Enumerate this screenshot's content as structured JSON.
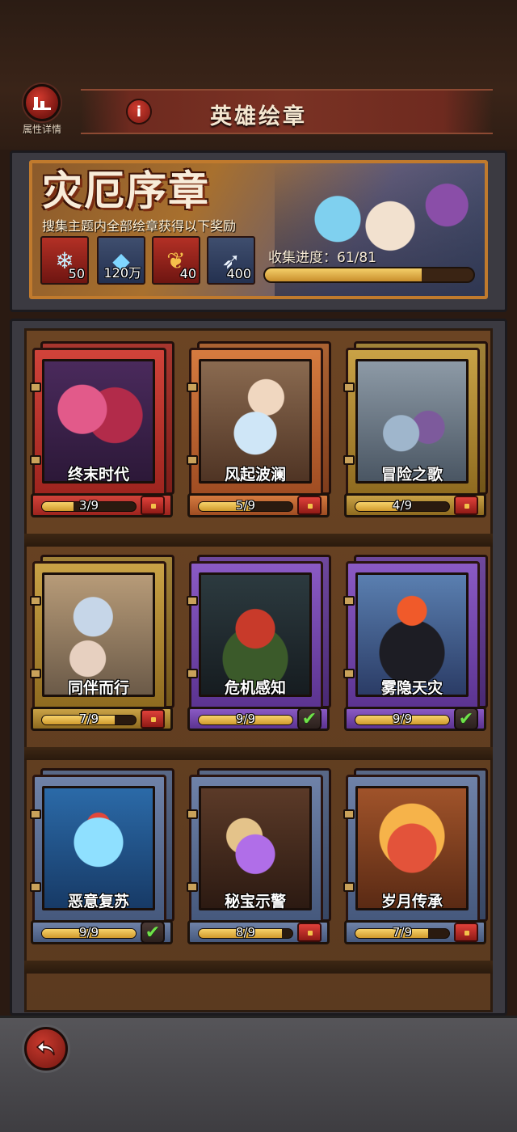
{
  "header": {
    "attr_label": "属性详情",
    "info_symbol": "i",
    "title": "英雄绘章"
  },
  "banner": {
    "title": "灾厄序章",
    "subtitle": "搜集主题内全部绘章获得以下奖励",
    "rewards": [
      {
        "icon": "ice-crystal-icon",
        "qty": "50"
      },
      {
        "icon": "blue-gem-icon",
        "qty": "120万"
      },
      {
        "icon": "golden-feather-icon",
        "qty": "40"
      },
      {
        "icon": "white-feather-icon",
        "qty": "400"
      }
    ],
    "progress_text": "收集进度：61/81",
    "progress_fraction": 0.753
  },
  "cards": [
    {
      "name": "终末时代",
      "progress": "3/9",
      "fraction": 0.333,
      "theme": "red",
      "badge": "chest"
    },
    {
      "name": "风起波澜",
      "progress": "5/9",
      "fraction": 0.556,
      "theme": "orange",
      "badge": "chest"
    },
    {
      "name": "冒险之歌",
      "progress": "4/9",
      "fraction": 0.444,
      "theme": "gold",
      "badge": "chest"
    },
    {
      "name": "同伴而行",
      "progress": "7/9",
      "fraction": 0.778,
      "theme": "gold",
      "badge": "chest"
    },
    {
      "name": "危机感知",
      "progress": "9/9",
      "fraction": 1.0,
      "theme": "purple",
      "badge": "check"
    },
    {
      "name": "雾隐天灾",
      "progress": "9/9",
      "fraction": 1.0,
      "theme": "purple",
      "badge": "check"
    },
    {
      "name": "恶意复苏",
      "progress": "9/9",
      "fraction": 1.0,
      "theme": "blue",
      "badge": "check"
    },
    {
      "name": "秘宝示警",
      "progress": "8/9",
      "fraction": 0.889,
      "theme": "blue",
      "badge": "chest"
    },
    {
      "name": "岁月传承",
      "progress": "7/9",
      "fraction": 0.778,
      "theme": "blue",
      "badge": "chest"
    }
  ],
  "colors": {
    "accent_red": "#c8392d",
    "progress_gold": "#f4cf6a",
    "check_green": "#6fe24a"
  }
}
